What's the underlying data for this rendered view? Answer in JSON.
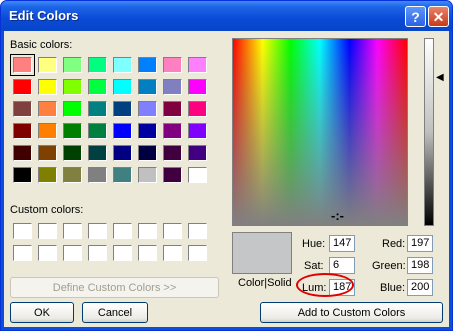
{
  "window": {
    "title": "Edit Colors"
  },
  "titlebar": {
    "help_glyph": "?",
    "close_glyph": "✕"
  },
  "labels": {
    "basic_colors": "Basic colors:",
    "custom_colors": "Custom colors:",
    "color_solid": "Color|Solid",
    "hue": "Hue:",
    "sat": "Sat:",
    "lum": "Lum:",
    "red": "Red:",
    "green": "Green:",
    "blue": "Blue:"
  },
  "values": {
    "hue": "147",
    "sat": "6",
    "lum": "187",
    "red": "197",
    "green": "198",
    "blue": "200"
  },
  "buttons": {
    "define_custom": "Define Custom Colors >>",
    "ok": "OK",
    "cancel": "Cancel",
    "add_custom": "Add to Custom Colors"
  },
  "basic_colors": [
    "#ff8080",
    "#ffff80",
    "#80ff80",
    "#00ff80",
    "#80ffff",
    "#0080ff",
    "#ff80c0",
    "#ff80ff",
    "#ff0000",
    "#ffff00",
    "#80ff00",
    "#00ff40",
    "#00ffff",
    "#0080c0",
    "#8080c0",
    "#ff00ff",
    "#804040",
    "#ff8040",
    "#00ff00",
    "#008080",
    "#004080",
    "#8080ff",
    "#800040",
    "#ff0080",
    "#800000",
    "#ff8000",
    "#008000",
    "#008040",
    "#0000ff",
    "#0000a0",
    "#800080",
    "#8000ff",
    "#400000",
    "#804000",
    "#004000",
    "#004040",
    "#000080",
    "#000040",
    "#400040",
    "#400080",
    "#000000",
    "#808000",
    "#808040",
    "#808080",
    "#408080",
    "#c0c0c0",
    "#400040",
    "#ffffff"
  ],
  "custom_colors": [
    "#ffffff",
    "#ffffff",
    "#ffffff",
    "#ffffff",
    "#ffffff",
    "#ffffff",
    "#ffffff",
    "#ffffff",
    "#ffffff",
    "#ffffff",
    "#ffffff",
    "#ffffff",
    "#ffffff",
    "#ffffff",
    "#ffffff",
    "#ffffff"
  ],
  "selected_color": "#c5c6c8"
}
